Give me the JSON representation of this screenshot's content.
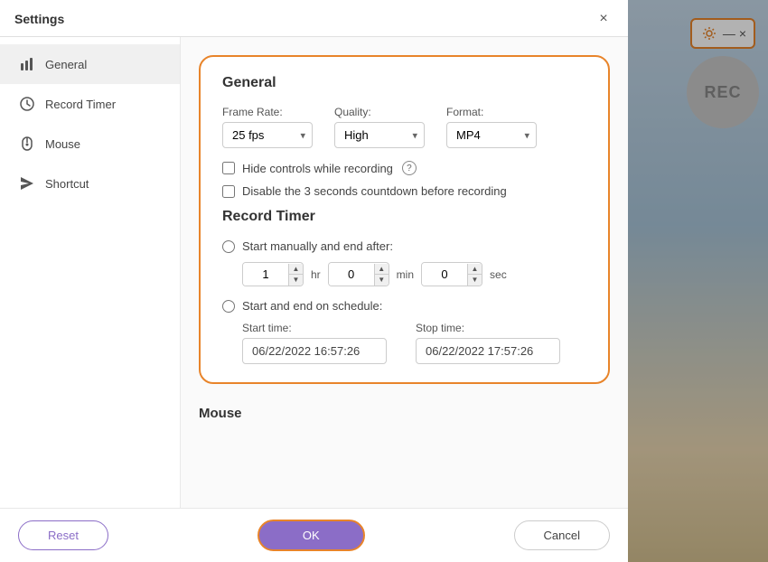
{
  "dialog": {
    "title": "Settings",
    "close_label": "×"
  },
  "sidebar": {
    "items": [
      {
        "id": "general",
        "label": "General",
        "icon": "chart-icon",
        "active": true
      },
      {
        "id": "record-timer",
        "label": "Record Timer",
        "icon": "clock-icon",
        "active": false
      },
      {
        "id": "mouse",
        "label": "Mouse",
        "icon": "mouse-icon",
        "active": false
      },
      {
        "id": "shortcut",
        "label": "Shortcut",
        "icon": "send-icon",
        "active": false
      }
    ]
  },
  "general": {
    "section_title": "General",
    "frame_rate_label": "Frame Rate:",
    "frame_rate_value": "25 fps",
    "quality_label": "Quality:",
    "quality_value": "High",
    "format_label": "Format:",
    "format_value": "MP4",
    "hide_controls_label": "Hide controls while recording",
    "disable_countdown_label": "Disable the 3 seconds countdown before recording"
  },
  "record_timer": {
    "section_title": "Record Timer",
    "start_manually_label": "Start manually and end after:",
    "hr_label": "hr",
    "min_label": "min",
    "sec_label": "sec",
    "hr_value": "1",
    "min_value": "0",
    "sec_value": "0",
    "start_end_schedule_label": "Start and end on schedule:",
    "start_time_label": "Start time:",
    "stop_time_label": "Stop time:",
    "start_time_value": "06/22/2022 16:57:26",
    "stop_time_value": "06/22/2022 17:57:26"
  },
  "mouse_peek": {
    "label": "Mouse"
  },
  "footer": {
    "reset_label": "Reset",
    "ok_label": "OK",
    "cancel_label": "Cancel"
  },
  "rec_button": {
    "label": "REC"
  }
}
